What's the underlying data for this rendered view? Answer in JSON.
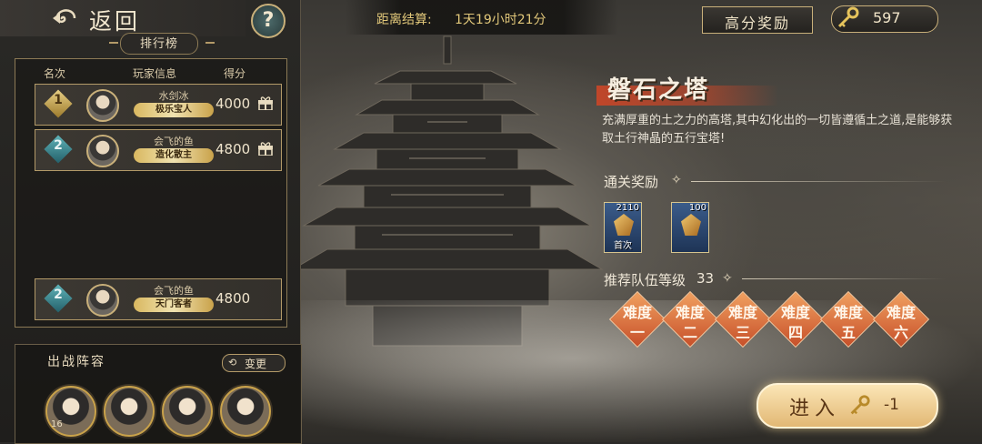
{
  "header": {
    "back_label": "返回",
    "help_label": "?",
    "countdown_label": "距离结算:",
    "countdown_value": "1天19小时21分",
    "reward_button": "高分奖励",
    "key_count": "597"
  },
  "ranking": {
    "title": "排行榜",
    "columns": [
      "名次",
      "玩家信息",
      "得分"
    ],
    "rows": [
      {
        "rank": "1",
        "name": "水剑冰",
        "title": "极乐宝人",
        "score": "4000"
      },
      {
        "rank": "2",
        "name": "会飞的鱼",
        "title": "造化散主",
        "score": "4800"
      }
    ],
    "self": {
      "rank": "2",
      "name": "会飞的鱼",
      "title": "天门客者",
      "score": "4800"
    }
  },
  "lineup": {
    "title": "出战阵容",
    "change_label": "变更",
    "change_icon": "⟲",
    "first_hero_level": "16",
    "heroes": [
      "hero-1",
      "hero-2",
      "hero-3",
      "hero-4"
    ]
  },
  "tower": {
    "name": "磐石之塔",
    "description": "充满厚重的土之力的高塔,其中幻化出的一切皆遵循土之道,是能够获取土行神晶的五行宝塔!",
    "rewards_title": "通关奖励",
    "rewards": [
      {
        "qty": "2110",
        "tag": "首次"
      },
      {
        "qty": "100",
        "tag": ""
      }
    ],
    "level_label": "推荐队伍等级",
    "level_value": "33",
    "star": "✧",
    "difficulties": [
      {
        "top": "难度",
        "bottom": "一"
      },
      {
        "top": "难度",
        "bottom": "二"
      },
      {
        "top": "难度",
        "bottom": "三"
      },
      {
        "top": "难度",
        "bottom": "四"
      },
      {
        "top": "难度",
        "bottom": "五"
      },
      {
        "top": "难度",
        "bottom": "六"
      }
    ]
  },
  "enter": {
    "label": "进入",
    "cost": "-1"
  },
  "colors": {
    "accent_gold": "#c9b07a",
    "difficulty_orange": "#e07840",
    "title_red": "#c64628"
  }
}
